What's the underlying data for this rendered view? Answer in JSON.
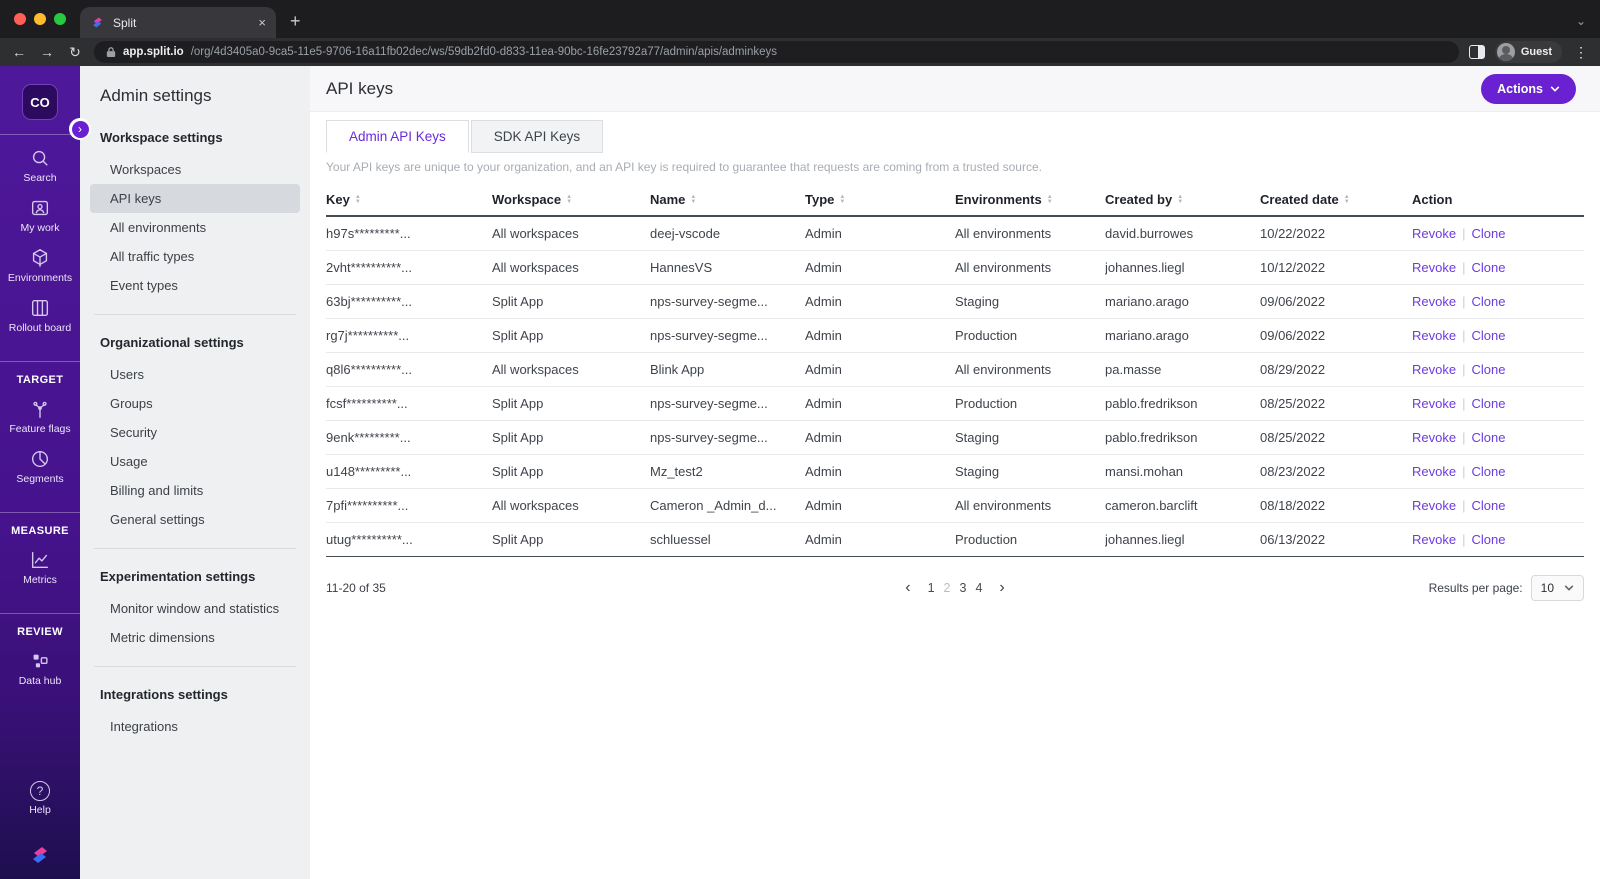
{
  "colors": {
    "accent_purple": "#6a21d1",
    "link_purple": "#6d3bdf",
    "sidebar_top": "#4e189b",
    "sidebar_bottom": "#1d0f4e"
  },
  "browser": {
    "tab_title": "Split",
    "close_tab": "×",
    "new_tab": "+",
    "back": "←",
    "forward": "→",
    "reload": "↻",
    "url_host": "app.split.io",
    "url_path": "/org/4d3405a0-9ca5-11e5-9706-16a11fb02dec/ws/59db2fd0-d833-11ea-90bc-16fe23792a77/admin/apis/adminkeys",
    "profile_label": "Guest",
    "menu_dots": "⋮",
    "strip_chevron": "⌄"
  },
  "sidebar": {
    "logo_text": "CO",
    "toggle_glyph": "›",
    "groups": [
      {
        "header": "",
        "items": [
          {
            "icon": "search-icon",
            "label": "Search"
          },
          {
            "icon": "my-work-icon",
            "label": "My work"
          },
          {
            "icon": "environments-icon",
            "label": "Environments"
          },
          {
            "icon": "rollout-board-icon",
            "label": "Rollout board"
          }
        ]
      },
      {
        "header": "TARGET",
        "items": [
          {
            "icon": "feature-flags-icon",
            "label": "Feature flags"
          },
          {
            "icon": "segments-icon",
            "label": "Segments"
          }
        ]
      },
      {
        "header": "MEASURE",
        "items": [
          {
            "icon": "metrics-icon",
            "label": "Metrics"
          }
        ]
      },
      {
        "header": "REVIEW",
        "items": [
          {
            "icon": "data-hub-icon",
            "label": "Data hub"
          }
        ]
      }
    ],
    "help_label": "Help",
    "help_glyph": "?"
  },
  "admin_nav": {
    "title": "Admin settings",
    "sections": [
      {
        "header": "Workspace settings",
        "selected": "API keys",
        "items": [
          "Workspaces",
          "API keys",
          "All environments",
          "All traffic types",
          "Event types"
        ]
      },
      {
        "header": "Organizational settings",
        "selected": "",
        "items": [
          "Users",
          "Groups",
          "Security",
          "Usage",
          "Billing and limits",
          "General settings"
        ]
      },
      {
        "header": "Experimentation settings",
        "selected": "",
        "items": [
          "Monitor window and statistics",
          "Metric dimensions"
        ]
      },
      {
        "header": "Integrations settings",
        "selected": "",
        "items": [
          "Integrations"
        ]
      }
    ]
  },
  "main": {
    "page_title": "API keys",
    "actions_button": "Actions",
    "tabs": [
      {
        "label": "Admin API Keys",
        "active": true
      },
      {
        "label": "SDK API Keys",
        "active": false
      }
    ],
    "description": "Your API keys are unique to your organization, and an API key is required to guarantee that requests are coming from a trusted source.",
    "table": {
      "columns": [
        {
          "label": "Key",
          "sortable": true
        },
        {
          "label": "Workspace",
          "sortable": true
        },
        {
          "label": "Name",
          "sortable": true
        },
        {
          "label": "Type",
          "sortable": true
        },
        {
          "label": "Environments",
          "sortable": true
        },
        {
          "label": "Created by",
          "sortable": true
        },
        {
          "label": "Created date",
          "sortable": true
        },
        {
          "label": "Action",
          "sortable": false
        }
      ],
      "rows": [
        {
          "key": "h97s*********...",
          "workspace": "All workspaces",
          "name": "deej-vscode",
          "type": "Admin",
          "environments": "All environments",
          "created_by": "david.burrowes",
          "created_date": "10/22/2022",
          "actions": [
            "Revoke",
            "Clone"
          ]
        },
        {
          "key": "2vht**********...",
          "workspace": "All workspaces",
          "name": "HannesVS",
          "type": "Admin",
          "environments": "All environments",
          "created_by": "johannes.liegl",
          "created_date": "10/12/2022",
          "actions": [
            "Revoke",
            "Clone"
          ]
        },
        {
          "key": "63bj**********...",
          "workspace": "Split App",
          "name": "nps-survey-segme...",
          "type": "Admin",
          "environments": "Staging",
          "created_by": "mariano.arago",
          "created_date": "09/06/2022",
          "actions": [
            "Revoke",
            "Clone"
          ]
        },
        {
          "key": "rg7j**********...",
          "workspace": "Split App",
          "name": "nps-survey-segme...",
          "type": "Admin",
          "environments": "Production",
          "created_by": "mariano.arago",
          "created_date": "09/06/2022",
          "actions": [
            "Revoke",
            "Clone"
          ]
        },
        {
          "key": "q8l6**********...",
          "workspace": "All workspaces",
          "name": "Blink App",
          "type": "Admin",
          "environments": "All environments",
          "created_by": "pa.masse",
          "created_date": "08/29/2022",
          "actions": [
            "Revoke",
            "Clone"
          ]
        },
        {
          "key": "fcsf**********...",
          "workspace": "Split App",
          "name": "nps-survey-segme...",
          "type": "Admin",
          "environments": "Production",
          "created_by": "pablo.fredrikson",
          "created_date": "08/25/2022",
          "actions": [
            "Revoke",
            "Clone"
          ]
        },
        {
          "key": "9enk*********...",
          "workspace": "Split App",
          "name": "nps-survey-segme...",
          "type": "Admin",
          "environments": "Staging",
          "created_by": "pablo.fredrikson",
          "created_date": "08/25/2022",
          "actions": [
            "Revoke",
            "Clone"
          ]
        },
        {
          "key": "u148*********...",
          "workspace": "Split App",
          "name": "Mz_test2",
          "type": "Admin",
          "environments": "Staging",
          "created_by": "mansi.mohan",
          "created_date": "08/23/2022",
          "actions": [
            "Revoke",
            "Clone"
          ]
        },
        {
          "key": "7pfi**********...",
          "workspace": "All workspaces",
          "name": "Cameron _Admin_d...",
          "type": "Admin",
          "environments": "All environments",
          "created_by": "cameron.barclift",
          "created_date": "08/18/2022",
          "actions": [
            "Revoke",
            "Clone"
          ]
        },
        {
          "key": "utug**********...",
          "workspace": "Split App",
          "name": "schluessel",
          "type": "Admin",
          "environments": "Production",
          "created_by": "johannes.liegl",
          "created_date": "06/13/2022",
          "actions": [
            "Revoke",
            "Clone"
          ]
        }
      ]
    },
    "pagination": {
      "range_label": "11-20 of 35",
      "prev": "‹",
      "next": "›",
      "pages": [
        "1",
        "2",
        "3",
        "4"
      ],
      "current_page": "2",
      "results_per_page_label": "Results per page:",
      "results_per_page_value": "10"
    }
  }
}
